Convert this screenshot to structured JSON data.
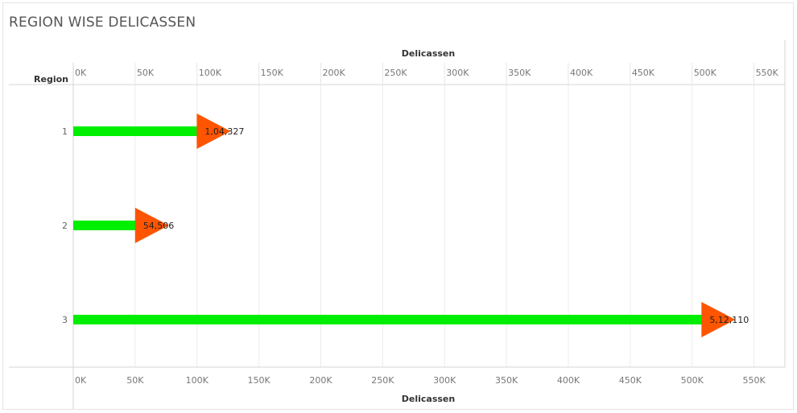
{
  "title": "REGION WISE DELICASSEN",
  "chart_data": {
    "type": "bar",
    "title": "REGION WISE DELICASSEN",
    "xlabel": "Delicassen",
    "ylabel": "Region",
    "categories": [
      "1",
      "2",
      "3"
    ],
    "values": [
      104327,
      54506,
      512110
    ],
    "data_labels": [
      "1,04,327",
      "54,506",
      "5,12,110"
    ],
    "xlim": [
      0,
      575000
    ],
    "x_ticks": [
      0,
      50000,
      100000,
      150000,
      200000,
      250000,
      300000,
      350000,
      400000,
      450000,
      500000,
      550000
    ],
    "x_tick_labels": [
      "0K",
      "50K",
      "100K",
      "150K",
      "200K",
      "250K",
      "300K",
      "350K",
      "400K",
      "450K",
      "500K",
      "550K"
    ],
    "grid": true,
    "bar_color": "#00ee00",
    "marker_color": "#ff5500",
    "marker_shape": "triangle-right"
  }
}
